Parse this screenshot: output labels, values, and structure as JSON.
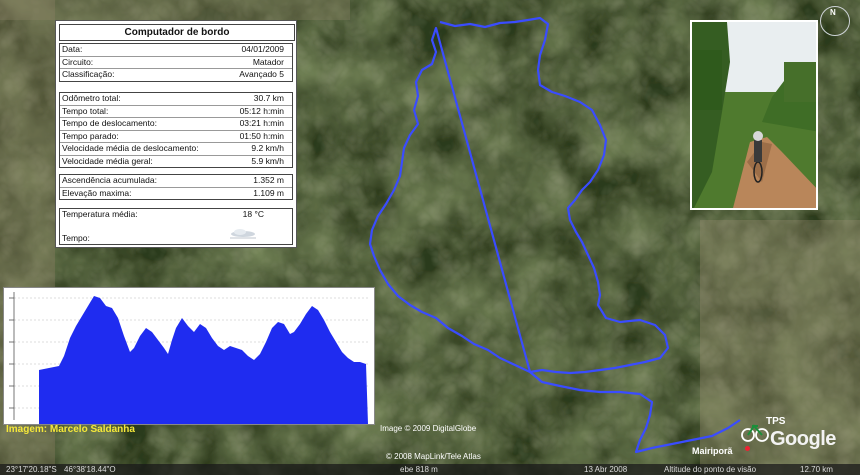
{
  "colors": {
    "route": "#3a4cff",
    "profile_fill": "#1f2cf0",
    "credit": "#f5e83a"
  },
  "computer": {
    "title": "Computador de bordo",
    "info": [
      {
        "label": "Data:",
        "value": "04/01/2009"
      },
      {
        "label": "Circuito:",
        "value": "Matador"
      },
      {
        "label": "Classificação:",
        "value": "Avançado 5"
      }
    ],
    "stats": [
      {
        "label": "Odômetro total:",
        "value": "30.7 km"
      },
      {
        "label": "Tempo total:",
        "value": "05:12 h:min"
      },
      {
        "label": "Tempo de deslocamento:",
        "value": "03:21 h:min"
      },
      {
        "label": "Tempo parado:",
        "value": "01:50 h:min"
      },
      {
        "label": "Velocidade média de deslocamento:",
        "value": "9.2 km/h"
      },
      {
        "label": "Velocidade média geral:",
        "value": "5.9 km/h"
      }
    ],
    "elevation": [
      {
        "label": "Ascendência acumulada:",
        "value": "1.352 m"
      },
      {
        "label": "Elevação maxima:",
        "value": "1.109 m"
      }
    ],
    "weather": {
      "temp_label": "Temperatura média:",
      "temp_value": "18 °C",
      "weather_label": "Tempo:"
    }
  },
  "credits": {
    "photo_credit": "Imagem: Marcelo Saldanha",
    "digitalglobe": "Image © 2009 DigitalGlobe",
    "maplink": "© 2008 MapLink/Tele Atlas",
    "eye": "ebe  818 m",
    "date": "13 Abr 2008",
    "eye_alt": "Altitude do ponto de visão",
    "eye_alt_value": "12.70 km",
    "coords_lat": "23°17'20.18\"S",
    "coords_lon": "46°38'18.44\"O",
    "place": "Mairiporã",
    "tps": "TPS",
    "google": "Google"
  }
}
